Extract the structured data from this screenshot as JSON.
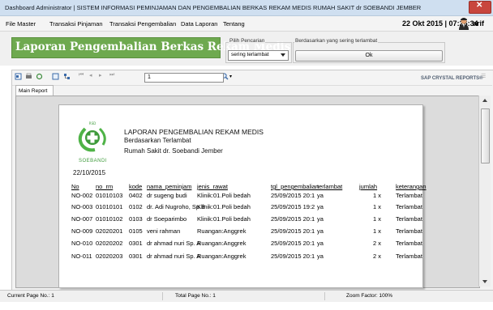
{
  "window": {
    "title": "Dashboard Administrator | SISTEM INFORMASI PEMINJAMAN DAN PENGEMBALIAN BERKAS REKAM MEDIS RUMAH SAKIT dr SOEBANDI JEMBER"
  },
  "menubar": {
    "items": [
      "File Master",
      "Transaksi Pinjaman",
      "Transaksi Pengembalian",
      "Data Laporan",
      "Tentang"
    ],
    "datetime": "22 Okt 2015 | 07:26:34",
    "user": "arif"
  },
  "header": {
    "title": "Laporan Pengembalian Berkas Rekam Medis",
    "search_label": "Pilih Pencarian",
    "search_value": "sering terlambat",
    "frequent_label": "Berdasarkan yang sering terlambat",
    "ok_label": "Ok"
  },
  "viewer": {
    "page_value": "1",
    "page_total": "/1",
    "brand": "SAP CRYSTAL REPORTS®",
    "tab_label": "Main Report"
  },
  "report": {
    "logo_text": "SOEBANDI",
    "title": "LAPORAN PENGEMBALIAN REKAM MEDIS",
    "subtitle": "Berdasarkan Terlambat",
    "hospital": "Rumah Sakit dr. Soebandi Jember",
    "date": "22/10/2015",
    "columns": [
      "No",
      "no_rm",
      "kode",
      "nama_peminjam",
      "jenis_rawat",
      "tgl_pengembalian",
      "terlambat",
      "jumlah",
      "keterangan"
    ],
    "rows": [
      {
        "no": "NO-002",
        "no_rm": "01010103",
        "kode": "0402",
        "nama": "dr sugeng budi",
        "jenis": "Klinik:01.Poli bedah",
        "tgl": "25/09/2015 20:1",
        "terlambat": "ya",
        "jumlah": "1 x",
        "ket": "Terlambat"
      },
      {
        "no": "NO-003",
        "no_rm": "01010101",
        "kode": "0102",
        "nama": "dr. Adi Nugroho, Sp.B",
        "jenis": "Klinik:01.Poli bedah",
        "tgl": "25/09/2015 19:2",
        "terlambat": "ya",
        "jumlah": "1 x",
        "ket": "Terlambat"
      },
      {
        "no": "NO-007",
        "no_rm": "01010102",
        "kode": "0103",
        "nama": "dr Soeparimbo",
        "jenis": "Klinik:01.Poli bedah",
        "tgl": "25/09/2015 20:1",
        "terlambat": "ya",
        "jumlah": "1 x",
        "ket": "Terlambat"
      },
      {
        "no": "NO-009",
        "no_rm": "02020201",
        "kode": "0105",
        "nama": "veni rahman",
        "jenis": "Ruangan:Anggrek",
        "tgl": "25/09/2015 20:1",
        "terlambat": "ya",
        "jumlah": "1 x",
        "ket": "Terlambat"
      },
      {
        "no": "NO-010",
        "no_rm": "02020202",
        "kode": "0301",
        "nama": "dr ahmad nuri Sp. A",
        "jenis": "Ruangan:Anggrek",
        "tgl": "25/09/2015 20:1",
        "terlambat": "ya",
        "jumlah": "2 x",
        "ket": "Terlambat"
      },
      {
        "no": "NO-011",
        "no_rm": "02020203",
        "kode": "0301",
        "nama": "dr ahmad nuri Sp. A",
        "jenis": "Ruangan:Anggrek",
        "tgl": "25/09/2015 20:1",
        "terlambat": "ya",
        "jumlah": "2 x",
        "ket": "Terlambat"
      }
    ]
  },
  "status": {
    "current_page": "Current Page No.: 1",
    "total_page": "Total Page No.: 1",
    "zoom": "Zoom Factor: 100%"
  },
  "colors": {
    "banner": "#6ea94f",
    "logo_green": "#3d9a3a"
  }
}
